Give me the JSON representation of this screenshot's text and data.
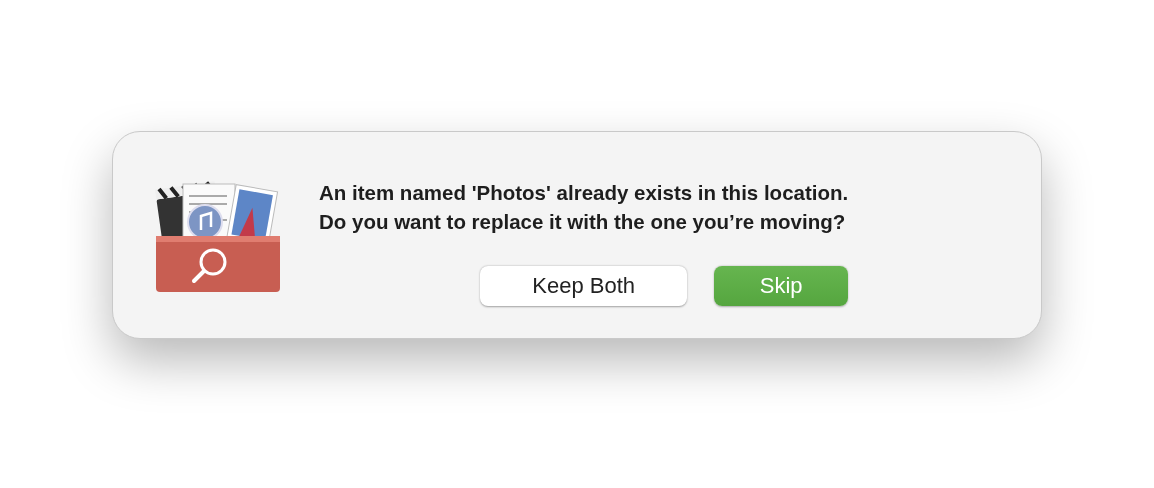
{
  "dialog": {
    "message_lines": [
      "An item named 'Photos' already exists in this location.",
      "Do you want to replace it with the one you’re moving?"
    ],
    "buttons": [
      {
        "label": "Keep Both",
        "kind": "secondary"
      },
      {
        "label": "Skip",
        "kind": "default"
      }
    ]
  }
}
